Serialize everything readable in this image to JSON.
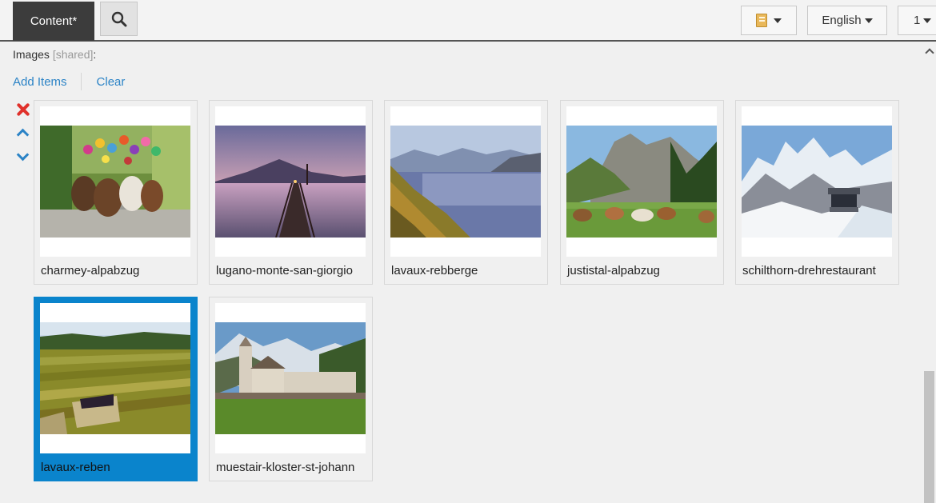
{
  "toolbar": {
    "content_tab": "Content*",
    "search_icon": "magnifier-icon",
    "notes_icon": "notebook-icon",
    "language": "English",
    "page_indicator": "1"
  },
  "field": {
    "label": "Images",
    "shared": "[shared]",
    "colon": ":",
    "add_items": "Add Items",
    "clear": "Clear"
  },
  "controls": {
    "remove_icon": "close-icon",
    "move_up_icon": "chevron-up-icon",
    "move_down_icon": "chevron-down-icon"
  },
  "accent_color": "#0a84cc",
  "link_color": "#2b83c6",
  "items": [
    {
      "caption": "charmey-alpabzug",
      "selected": false
    },
    {
      "caption": "lugano-monte-san-giorgio",
      "selected": false
    },
    {
      "caption": "lavaux-rebberge",
      "selected": false
    },
    {
      "caption": "justistal-alpabzug",
      "selected": false
    },
    {
      "caption": "schilthorn-drehrestaurant",
      "selected": false
    },
    {
      "caption": "lavaux-reben",
      "selected": true
    },
    {
      "caption": "muestair-kloster-st-johann",
      "selected": false
    }
  ]
}
